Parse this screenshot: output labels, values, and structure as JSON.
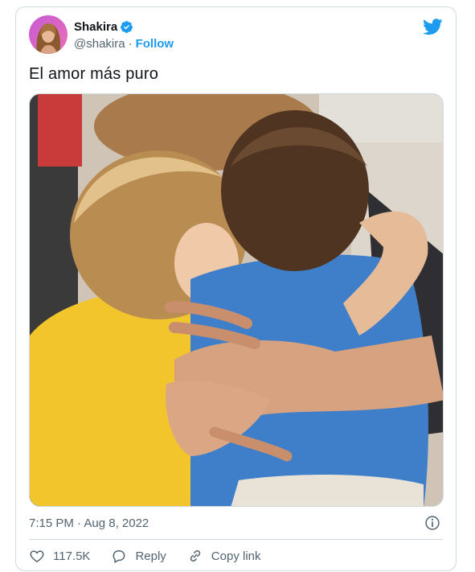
{
  "tweet": {
    "author": {
      "display_name": "Shakira",
      "handle": "@shakira",
      "separator": "·",
      "follow_label": "Follow",
      "verified": true
    },
    "text": "El amor más puro",
    "timestamp": "7:15 PM · Aug 8, 2022",
    "actions": {
      "likes_count": "117.5K",
      "reply_label": "Reply",
      "copy_link_label": "Copy link"
    }
  },
  "icons": {
    "brand": "twitter-bird-icon",
    "verified": "verified-badge-icon",
    "info": "info-icon",
    "like": "heart-icon",
    "reply": "reply-bubble-icon",
    "copy": "link-icon"
  },
  "colors": {
    "accent": "#1d9bf0",
    "text_primary": "#0f1419",
    "text_secondary": "#536471",
    "border": "#cfd9de"
  }
}
